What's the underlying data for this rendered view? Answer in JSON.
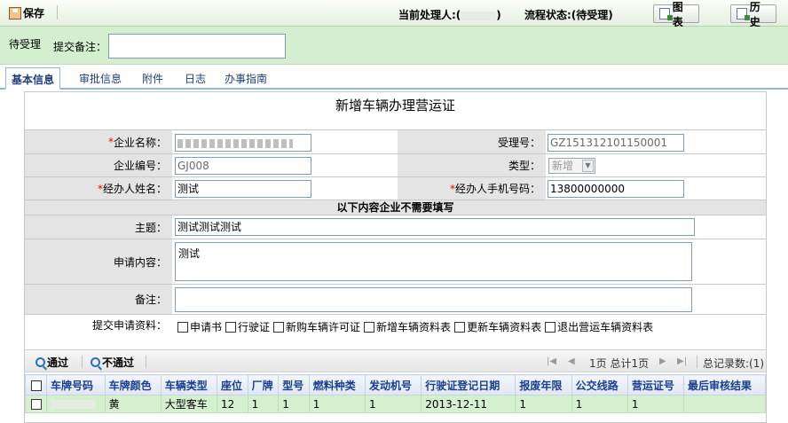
{
  "toolbar": {
    "save_label": "保存",
    "handler_label": "当前处理人:(",
    "handler_suffix": ")",
    "status_label": "流程状态:(待受理)",
    "chart_label": "图表",
    "history_label": "历史"
  },
  "pending": {
    "status_text": "待受理",
    "remark_label": "提交备注：",
    "remark_value": ""
  },
  "tabs": [
    {
      "label": "基本信息",
      "active": true
    },
    {
      "label": "审批信息",
      "active": false
    },
    {
      "label": "附件",
      "active": false
    },
    {
      "label": "日志",
      "active": false
    },
    {
      "label": "办事指南",
      "active": false
    }
  ],
  "form": {
    "title": "新增车辆办理营运证",
    "company_name_label": "企业名称：",
    "acceptance_no_label": "受理号：",
    "acceptance_no_value": "GZ151312101150001",
    "company_code_label": "企业编号：",
    "company_code_value": "GJ008",
    "type_label": "类型：",
    "type_value": "新增",
    "handler_name_label": "经办人姓名：",
    "handler_name_value": "测试",
    "handler_phone_label": "经办人手机号码：",
    "handler_phone_value": "13800000000",
    "section_label": "以下内容企业不需要填写",
    "subject_label": "主题：",
    "subject_value": "测试测试测试",
    "content_label": "申请内容：",
    "content_value": "测试",
    "notes_label": "备注：",
    "notes_value": "",
    "materials_label": "提交申请资料：",
    "materials": [
      "申请书",
      "行驶证",
      "新购车辆许可证",
      "新增车辆资料表",
      "更新车辆资料表",
      "退出营运车辆资料表"
    ],
    "required_mark": "*"
  },
  "list": {
    "pass_label": "通过",
    "reject_label": "不通过",
    "page_text": "1页 总计1页",
    "total_text": "总记录数:(1)",
    "columns": [
      "车牌号码",
      "车牌颜色",
      "车辆类型",
      "座位",
      "厂牌",
      "型号",
      "燃料种类",
      "发动机号",
      "行驶证登记日期",
      "报废年限",
      "公交线路",
      "营运证号",
      "最后审核结果"
    ],
    "rows": [
      [
        "",
        "黄",
        "大型客车",
        "12",
        "1",
        "1",
        "1",
        "1",
        "2013-12-11",
        "1",
        "1",
        "1",
        ""
      ]
    ]
  }
}
